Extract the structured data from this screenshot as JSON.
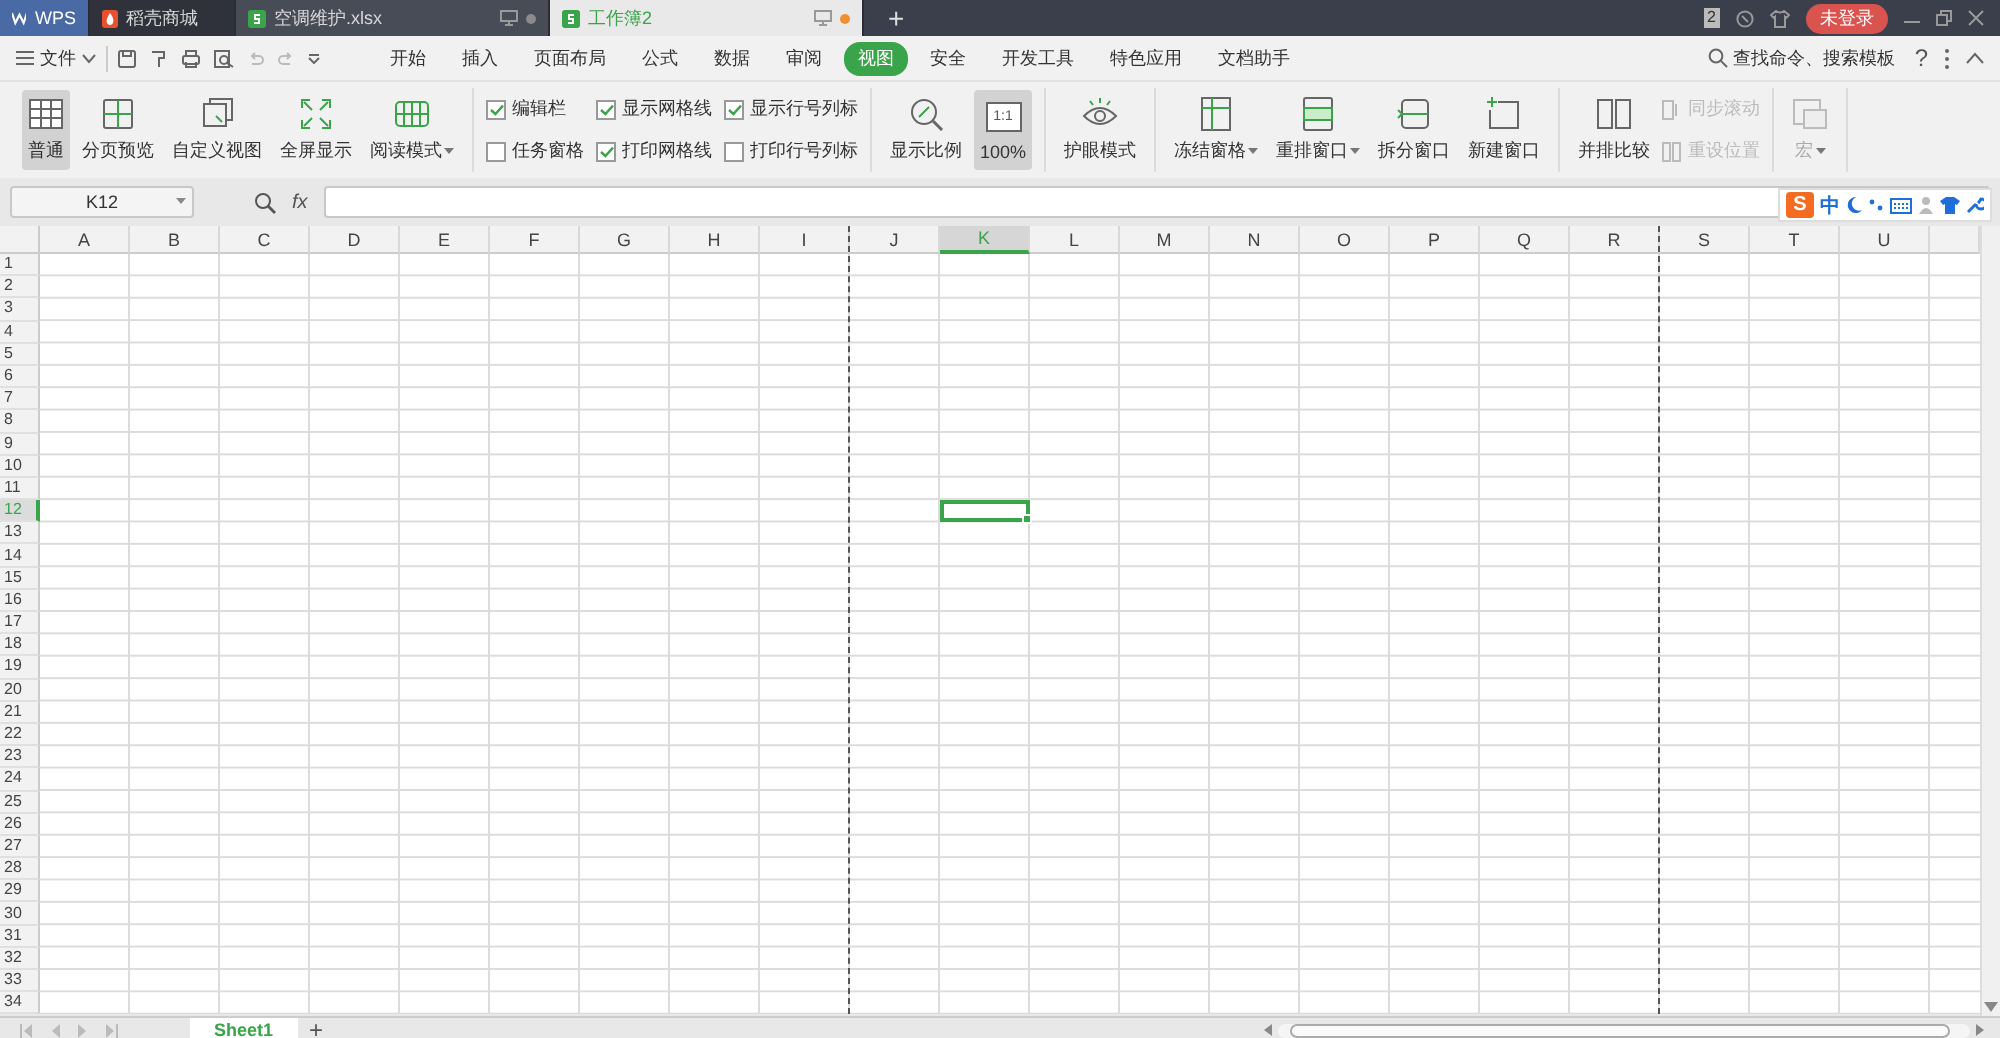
{
  "title_bar": {
    "tabs": [
      {
        "kind": "app",
        "label": "WPS",
        "selected": false
      },
      {
        "kind": "store",
        "label": "稻壳商城",
        "selected": false
      },
      {
        "kind": "sheet",
        "label": "空调维护.xlsx",
        "selected": false,
        "modified": false
      },
      {
        "kind": "sheet",
        "label": "工作簿2",
        "selected": true,
        "modified": true
      }
    ],
    "new_tab": "+",
    "window_count": "2",
    "login": "未登录"
  },
  "menu_bar": {
    "file": "文件",
    "tabs": [
      {
        "label": "开始",
        "selected": false
      },
      {
        "label": "插入",
        "selected": false
      },
      {
        "label": "页面布局",
        "selected": false
      },
      {
        "label": "公式",
        "selected": false
      },
      {
        "label": "数据",
        "selected": false
      },
      {
        "label": "审阅",
        "selected": false
      },
      {
        "label": "视图",
        "selected": true
      },
      {
        "label": "安全",
        "selected": false
      },
      {
        "label": "开发工具",
        "selected": false
      },
      {
        "label": "特色应用",
        "selected": false
      },
      {
        "label": "文档助手",
        "selected": false
      }
    ],
    "search": "查找命令、搜索模板",
    "help": "?"
  },
  "ribbon": {
    "groups": [
      {
        "items": [
          {
            "kind": "large",
            "label": "普通",
            "selected": true,
            "dropdown": false,
            "disabled": false
          },
          {
            "kind": "large",
            "label": "分页预览",
            "selected": false,
            "dropdown": false,
            "disabled": false
          },
          {
            "kind": "large",
            "label": "自定义视图",
            "selected": false,
            "dropdown": false,
            "disabled": false
          },
          {
            "kind": "large",
            "label": "全屏显示",
            "selected": false,
            "dropdown": false,
            "disabled": false
          },
          {
            "kind": "large",
            "label": "阅读模式",
            "selected": false,
            "dropdown": true,
            "disabled": false
          }
        ]
      },
      {
        "items": [
          {
            "kind": "check",
            "label": "编辑栏",
            "checked": true
          },
          {
            "kind": "check",
            "label": "任务窗格",
            "checked": false
          },
          {
            "kind": "check",
            "label": "显示网格线",
            "checked": true
          },
          {
            "kind": "check",
            "label": "打印网格线",
            "checked": true
          },
          {
            "kind": "check",
            "label": "显示行号列标",
            "checked": true
          },
          {
            "kind": "check",
            "label": "打印行号列标",
            "checked": false
          }
        ]
      },
      {
        "items": [
          {
            "kind": "large",
            "label": "显示比例",
            "selected": false,
            "dropdown": false,
            "disabled": false
          },
          {
            "kind": "large",
            "label": "100%",
            "icon_text": "1:1",
            "selected": true,
            "dropdown": false,
            "disabled": false
          }
        ]
      },
      {
        "items": [
          {
            "kind": "large",
            "label": "护眼模式",
            "selected": false,
            "dropdown": false,
            "disabled": false
          }
        ]
      },
      {
        "items": [
          {
            "kind": "large",
            "label": "冻结窗格",
            "selected": false,
            "dropdown": true,
            "disabled": false
          },
          {
            "kind": "large",
            "label": "重排窗口",
            "selected": false,
            "dropdown": true,
            "disabled": false
          },
          {
            "kind": "large",
            "label": "拆分窗口",
            "selected": false,
            "dropdown": false,
            "disabled": false
          },
          {
            "kind": "large",
            "label": "新建窗口",
            "selected": false,
            "dropdown": false,
            "disabled": false
          }
        ]
      },
      {
        "items": [
          {
            "kind": "large",
            "label": "并排比较",
            "selected": false,
            "dropdown": false,
            "disabled": false
          },
          {
            "kind": "small",
            "label": "同步滚动",
            "disabled": true
          },
          {
            "kind": "small",
            "label": "重设位置",
            "disabled": true
          }
        ]
      },
      {
        "items": [
          {
            "kind": "large",
            "label": "宏",
            "selected": false,
            "dropdown": true,
            "disabled": true
          }
        ]
      }
    ]
  },
  "formula_bar": {
    "name_box": "K12",
    "fx": "fx",
    "ime": {
      "logo": "S",
      "mode": "中"
    }
  },
  "grid": {
    "columns": [
      {
        "label": "A",
        "selected": false,
        "page_break": false
      },
      {
        "label": "B",
        "selected": false,
        "page_break": false
      },
      {
        "label": "C",
        "selected": false,
        "page_break": false
      },
      {
        "label": "D",
        "selected": false,
        "page_break": false
      },
      {
        "label": "E",
        "selected": false,
        "page_break": false
      },
      {
        "label": "F",
        "selected": false,
        "page_break": false
      },
      {
        "label": "G",
        "selected": false,
        "page_break": false
      },
      {
        "label": "H",
        "selected": false,
        "page_break": false
      },
      {
        "label": "I",
        "selected": false,
        "page_break": true
      },
      {
        "label": "J",
        "selected": false,
        "page_break": false
      },
      {
        "label": "K",
        "selected": true,
        "page_break": false
      },
      {
        "label": "L",
        "selected": false,
        "page_break": false
      },
      {
        "label": "M",
        "selected": false,
        "page_break": false
      },
      {
        "label": "N",
        "selected": false,
        "page_break": false
      },
      {
        "label": "O",
        "selected": false,
        "page_break": false
      },
      {
        "label": "P",
        "selected": false,
        "page_break": false
      },
      {
        "label": "Q",
        "selected": false,
        "page_break": false
      },
      {
        "label": "R",
        "selected": false,
        "page_break": true
      },
      {
        "label": "S",
        "selected": false,
        "page_break": false
      },
      {
        "label": "T",
        "selected": false,
        "page_break": false
      },
      {
        "label": "U",
        "selected": false,
        "page_break": false
      }
    ],
    "rows": [
      {
        "label": "1",
        "selected": false
      },
      {
        "label": "2",
        "selected": false
      },
      {
        "label": "3",
        "selected": false
      },
      {
        "label": "4",
        "selected": false
      },
      {
        "label": "5",
        "selected": false
      },
      {
        "label": "6",
        "selected": false
      },
      {
        "label": "7",
        "selected": false
      },
      {
        "label": "8",
        "selected": false
      },
      {
        "label": "9",
        "selected": false
      },
      {
        "label": "10",
        "selected": false
      },
      {
        "label": "11",
        "selected": false
      },
      {
        "label": "12",
        "selected": true
      },
      {
        "label": "13",
        "selected": false
      },
      {
        "label": "14",
        "selected": false
      },
      {
        "label": "15",
        "selected": false
      },
      {
        "label": "16",
        "selected": false
      },
      {
        "label": "17",
        "selected": false
      },
      {
        "label": "18",
        "selected": false
      },
      {
        "label": "19",
        "selected": false
      },
      {
        "label": "20",
        "selected": false
      },
      {
        "label": "21",
        "selected": false
      },
      {
        "label": "22",
        "selected": false
      },
      {
        "label": "23",
        "selected": false
      },
      {
        "label": "24",
        "selected": false
      },
      {
        "label": "25",
        "selected": false
      },
      {
        "label": "26",
        "selected": false
      },
      {
        "label": "27",
        "selected": false
      },
      {
        "label": "28",
        "selected": false
      },
      {
        "label": "29",
        "selected": false
      },
      {
        "label": "30",
        "selected": false
      },
      {
        "label": "31",
        "selected": false
      },
      {
        "label": "32",
        "selected": false
      },
      {
        "label": "33",
        "selected": false
      },
      {
        "label": "34",
        "selected": false
      }
    ]
  },
  "sheet_bar": {
    "sheets": [
      {
        "label": "Sheet1",
        "selected": true
      }
    ],
    "add": "+"
  }
}
